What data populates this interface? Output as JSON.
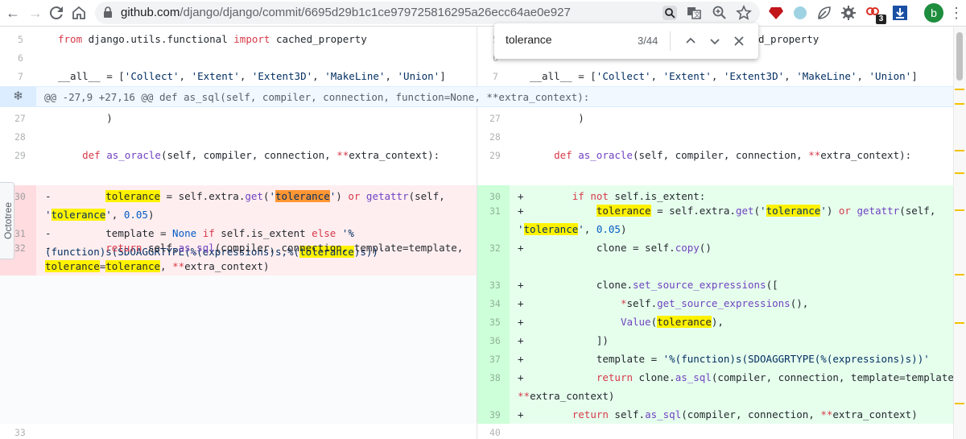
{
  "browser": {
    "url_host": "github.com",
    "url_path": "/django/django/commit/6695d29b1c1ce979725816295a26ecc64ae0e927",
    "profile_initial": "b",
    "extension_badge": "3"
  },
  "find_bar": {
    "query": "tolerance",
    "count": "3/44"
  },
  "sidebar": {
    "octotree_label": "Octotree"
  },
  "diff": {
    "hunk_header": "@@ -27,9 +27,16 @@ def as_sql(self, compiler, connection, function=None, **extra_context):",
    "left": {
      "line_numbers": [
        "5",
        "6",
        "7",
        "27",
        "28",
        "29",
        "30",
        "31",
        "32",
        "33"
      ]
    },
    "right": {
      "line_numbers": [
        "5",
        "6",
        "7",
        "27",
        "28",
        "29",
        "30",
        "31",
        "32",
        "33",
        "34",
        "35",
        "36",
        "37",
        "38",
        "39",
        "40"
      ]
    },
    "markers": {
      "del": "-",
      "add": "+"
    }
  },
  "colors": {
    "deletion": "#ffeef0",
    "addition": "#e6ffed",
    "highlight": "#fff200",
    "current_highlight": "#ff9632"
  },
  "icons": [
    "back-arrow-icon",
    "forward-arrow-icon",
    "reload-icon",
    "home-icon",
    "lock-icon",
    "search-page-icon",
    "translate-icon",
    "zoom-icon",
    "star-icon",
    "extension-icons",
    "expand-icon",
    "chevron-up-icon",
    "chevron-down-icon",
    "close-icon"
  ]
}
